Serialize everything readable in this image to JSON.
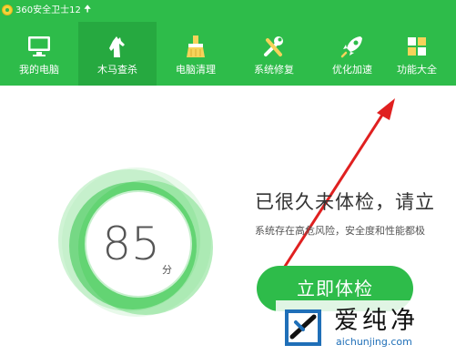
{
  "titlebar": {
    "title": "360安全卫士12",
    "update_icon": "up-arrow-icon"
  },
  "nav": {
    "items": [
      {
        "label": "我的电脑",
        "icon": "computer-icon",
        "active": false
      },
      {
        "label": "木马查杀",
        "icon": "horse-icon",
        "active": true
      },
      {
        "label": "电脑清理",
        "icon": "broom-icon",
        "active": false
      },
      {
        "label": "系统修复",
        "icon": "tools-icon",
        "active": false
      },
      {
        "label": "优化加速",
        "icon": "rocket-icon",
        "active": false
      },
      {
        "label": "功能大全",
        "icon": "grid-icon",
        "active": false
      }
    ]
  },
  "score": {
    "value": "85",
    "unit": "分"
  },
  "main": {
    "headline": "已很久未体检，请立",
    "subline": "系统存在高危风险，安全度和性能都极",
    "check_button": "立即体检"
  },
  "watermark": {
    "title": "爱纯净",
    "url": "aichunjing.com"
  },
  "colors": {
    "brand_green": "#2ebc4a",
    "active_tab": "#26a940",
    "annotation_arrow": "#e02020"
  }
}
